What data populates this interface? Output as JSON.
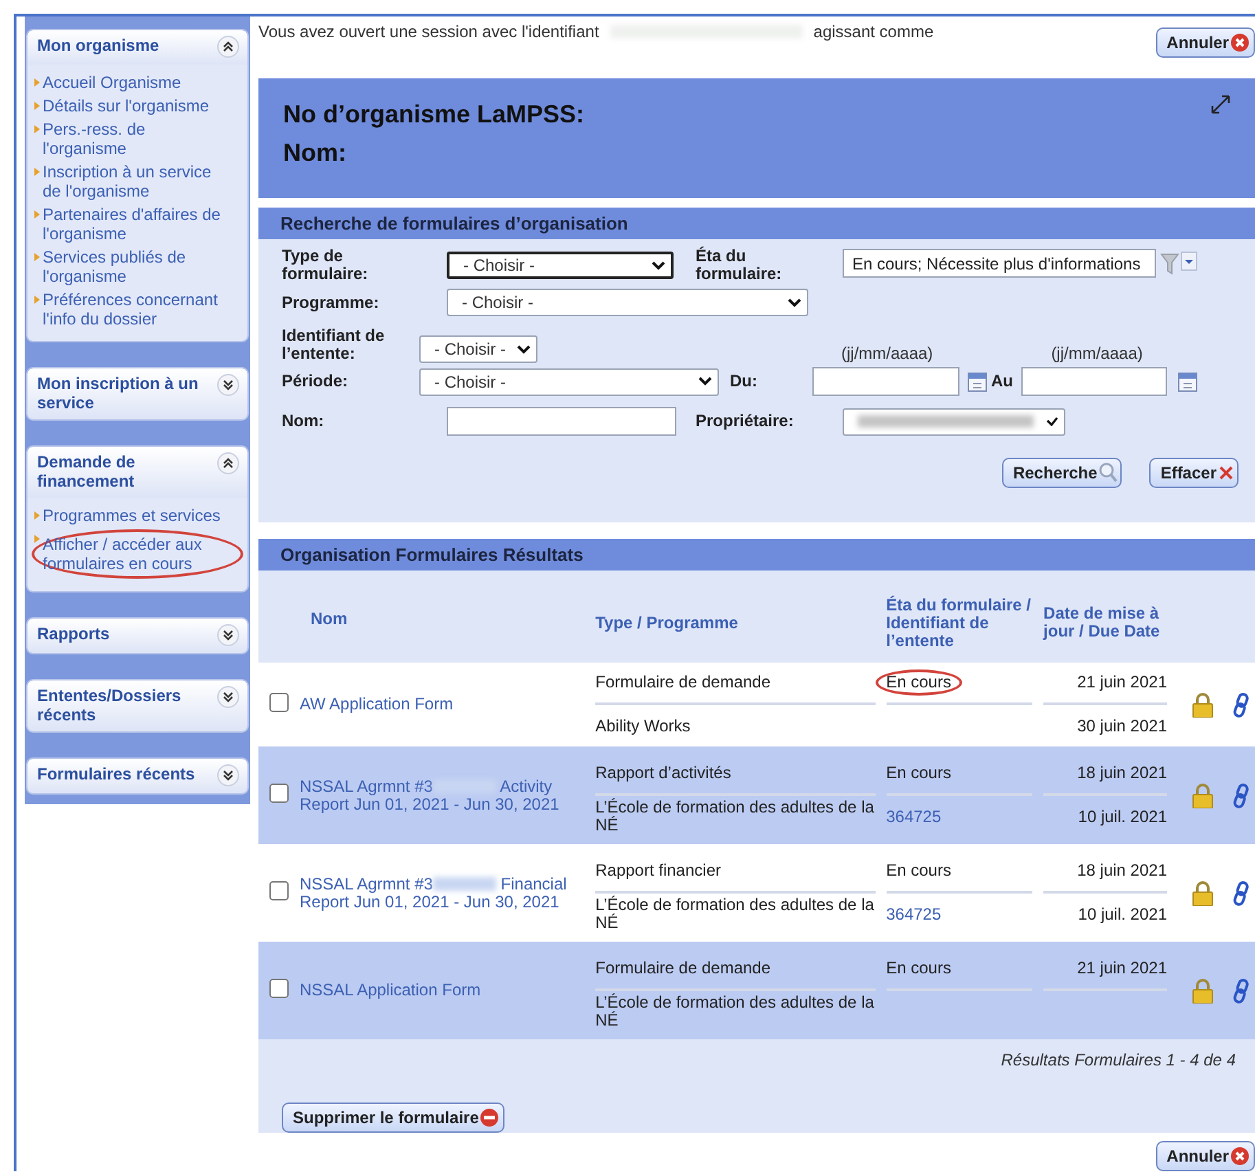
{
  "session": {
    "text_before": "Vous avez ouvert une session avec l'identifiant",
    "text_after": "agissant comme",
    "cancel": "Annuler"
  },
  "sidebar": [
    {
      "title": "Mon organisme",
      "expanded": true,
      "items": [
        {
          "label": "Accueil Organisme",
          "circled": false
        },
        {
          "label": "Détails sur l'organisme",
          "circled": false
        },
        {
          "label": "Pers.-ress. de l'organisme",
          "circled": false
        },
        {
          "label": "Inscription à un service de l'organisme",
          "circled": false
        },
        {
          "label": "Partenaires d'affaires de l'organisme",
          "circled": false
        },
        {
          "label": "Services publiés de l'organisme",
          "circled": false
        },
        {
          "label": "Préférences concernant l'info du dossier",
          "circled": false
        }
      ]
    },
    {
      "title": "Mon inscription à un service",
      "expanded": false
    },
    {
      "title": "Demande de financement",
      "expanded": true,
      "items": [
        {
          "label": "Programmes et services",
          "circled": false
        },
        {
          "label": "Afficher / accéder aux formulaires en cours",
          "circled": true
        }
      ]
    },
    {
      "title": "Rapports",
      "expanded": false
    },
    {
      "title": "Ententes/Dossiers récents",
      "expanded": false
    },
    {
      "title": "Formulaires récents",
      "expanded": false
    }
  ],
  "header": {
    "org_number_label": "No d’organisme LaMPSS:",
    "name_label": "Nom:"
  },
  "search": {
    "title": "Recherche de formulaires d’organisation",
    "form_type": {
      "label": "Type de formulaire:",
      "value": "- Choisir -"
    },
    "form_state": {
      "label": "Éta du formulaire:",
      "value": "En cours; Nécessite plus d'informations"
    },
    "program": {
      "label": "Programme:",
      "value": "- Choisir -"
    },
    "agreement_id": {
      "label": "Identifiant de l’entente:",
      "value": "- Choisir -"
    },
    "period": {
      "label": "Période:",
      "value": "- Choisir -"
    },
    "from": {
      "label": "Du:",
      "hint": "(jj/mm/aaaa)"
    },
    "to": {
      "label": "Au",
      "hint": "(jj/mm/aaaa)"
    },
    "name": {
      "label": "Nom:"
    },
    "owner": {
      "label": "Propriétaire:"
    },
    "search_button": "Recherche",
    "clear_button": "Effacer"
  },
  "results": {
    "title": "Organisation Formulaires Résultats",
    "columns": [
      "Nom",
      "Type / Programme",
      "Éta du formulaire / Identifiant de l’entente",
      "Date de mise à jour / Due Date"
    ],
    "rows": [
      {
        "checked": false,
        "name_start": "AW Application Form",
        "type": "Formulaire de demande",
        "program": "Ability Works",
        "status": "En cours",
        "status_circled": true,
        "updated": "21 juin 2021",
        "due": "30 juin 2021"
      },
      {
        "checked": false,
        "name_start": "NSSAL Agrmnt #3",
        "name_end": "Activity Report Jun 01, 2021 - Jun 30, 2021",
        "type": "Rapport d’activités",
        "program": "L’École de formation des adultes de la NÉ",
        "status": "En cours",
        "status_circled": false,
        "agreement_id": "364725",
        "updated": "18 juin 2021",
        "due": "10 juil. 2021"
      },
      {
        "checked": false,
        "name_start": "NSSAL Agrmnt #3",
        "name_end": "Financial Report Jun 01, 2021 - Jun 30, 2021",
        "type": "Rapport financier",
        "program": "L’École de formation des adultes de la NÉ",
        "status": "En cours",
        "status_circled": false,
        "agreement_id": "364725",
        "updated": "18 juin 2021",
        "due": "10 juil. 2021"
      },
      {
        "checked": false,
        "name_start": "NSSAL Application Form",
        "type": "Formulaire de demande",
        "program": "L’École de formation des adultes de la NÉ",
        "status": "En cours",
        "status_circled": false,
        "updated": "21 juin 2021"
      }
    ],
    "summary": "Résultats Formulaires 1 - 4 de 4",
    "delete_button": "Supprimer le formulaire"
  },
  "footer": {
    "cancel": "Annuler"
  }
}
